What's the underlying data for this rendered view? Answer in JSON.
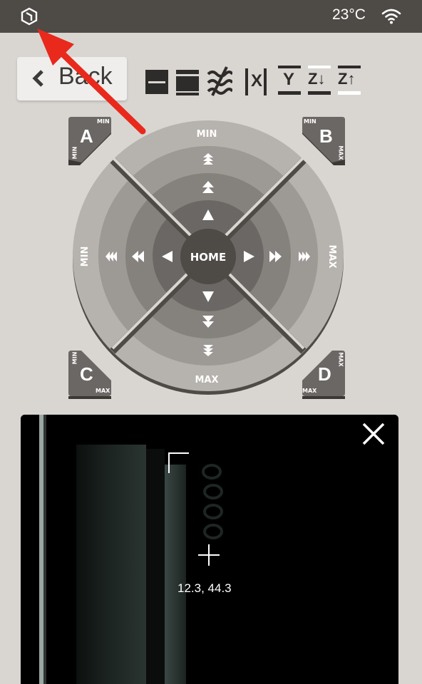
{
  "status_bar": {
    "temperature": "23°C"
  },
  "back_button": {
    "label": "Back"
  },
  "corners": {
    "a": {
      "letter": "A",
      "top": "MIN",
      "side": "MIN"
    },
    "b": {
      "letter": "B",
      "top": "MIN",
      "side": "MAX"
    },
    "c": {
      "letter": "C",
      "top": "MIN",
      "side": "MAX"
    },
    "d": {
      "letter": "D",
      "top": "MAX",
      "side": "MAX"
    }
  },
  "joystick": {
    "top_label": "MIN",
    "bottom_label": "MAX",
    "left_label": "MIN",
    "right_label": "MAX",
    "center_label": "HOME"
  },
  "toolbar": {
    "icons": [
      "save-icon",
      "load-icon",
      "vibration-off-icon",
      "x-axis-icon",
      "y-axis-icon",
      "z-down-icon",
      "z-up-icon"
    ],
    "labels": {
      "x": "X",
      "y": "Y",
      "z_down": "Z↓",
      "z_up": "Z↑"
    }
  },
  "camera": {
    "coords": "12.3, 44.3"
  },
  "colors": {
    "status_bar": "#4e4a46",
    "background": "#d9d6d2",
    "arrow": "#e8291c"
  }
}
